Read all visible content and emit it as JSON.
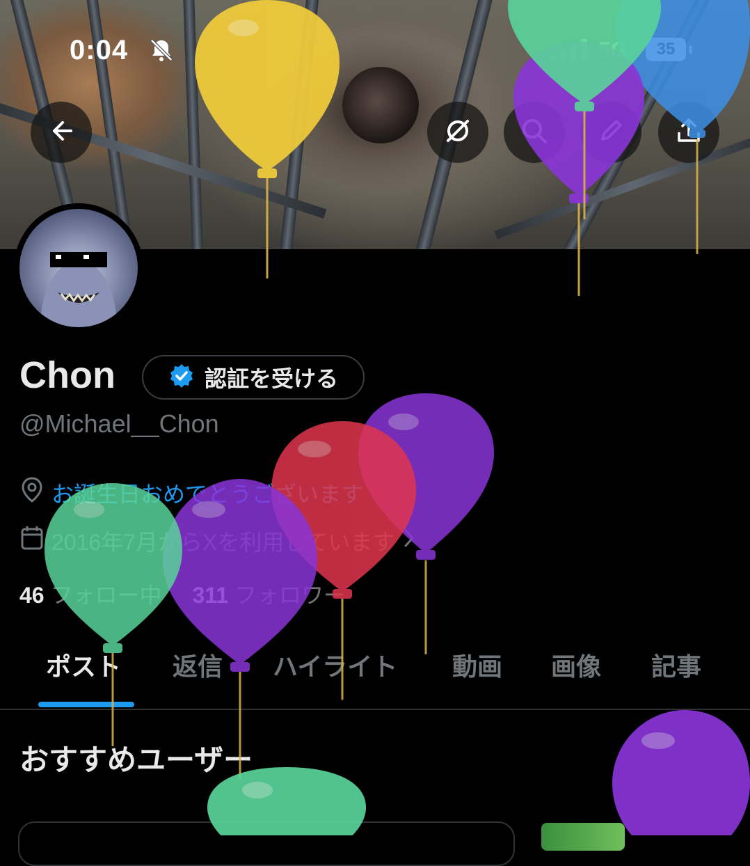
{
  "status_bar": {
    "time": "0:04",
    "network": "5G",
    "battery": "35"
  },
  "profile": {
    "display_name": "Chon",
    "verify_button_label": "認証を受ける",
    "handle": "@Michael__Chon",
    "birthday_text": "お誕生日おめでとうございます",
    "joined_text": "2016年7月からXを利用しています",
    "following_count": "46",
    "following_label": "フォロー中",
    "followers_count": "311",
    "followers_label": "フォロワー"
  },
  "tabs": [
    {
      "label": "ポスト",
      "active": true
    },
    {
      "label": "返信",
      "active": false
    },
    {
      "label": "ハイライト",
      "active": false
    },
    {
      "label": "動画",
      "active": false
    },
    {
      "label": "画像",
      "active": false
    },
    {
      "label": "記事",
      "active": false
    }
  ],
  "section": {
    "title": "おすすめユーザー"
  },
  "icons": [
    "back-arrow-icon",
    "grok-icon",
    "search-icon",
    "pencil-icon",
    "share-icon",
    "location-pin-icon",
    "calendar-icon",
    "chevron-right-icon",
    "verified-badge-icon",
    "bell-muted-icon",
    "signal-icon"
  ],
  "colors": {
    "accent": "#1d9bf0",
    "muted_text": "#71767b",
    "background": "#000000",
    "balloon_green": "#59d49a",
    "balloon_purple": "#8a35d8",
    "balloon_red": "#e0364d",
    "balloon_yellow": "#f2cd3a",
    "balloon_blue": "#3d8fe6"
  }
}
